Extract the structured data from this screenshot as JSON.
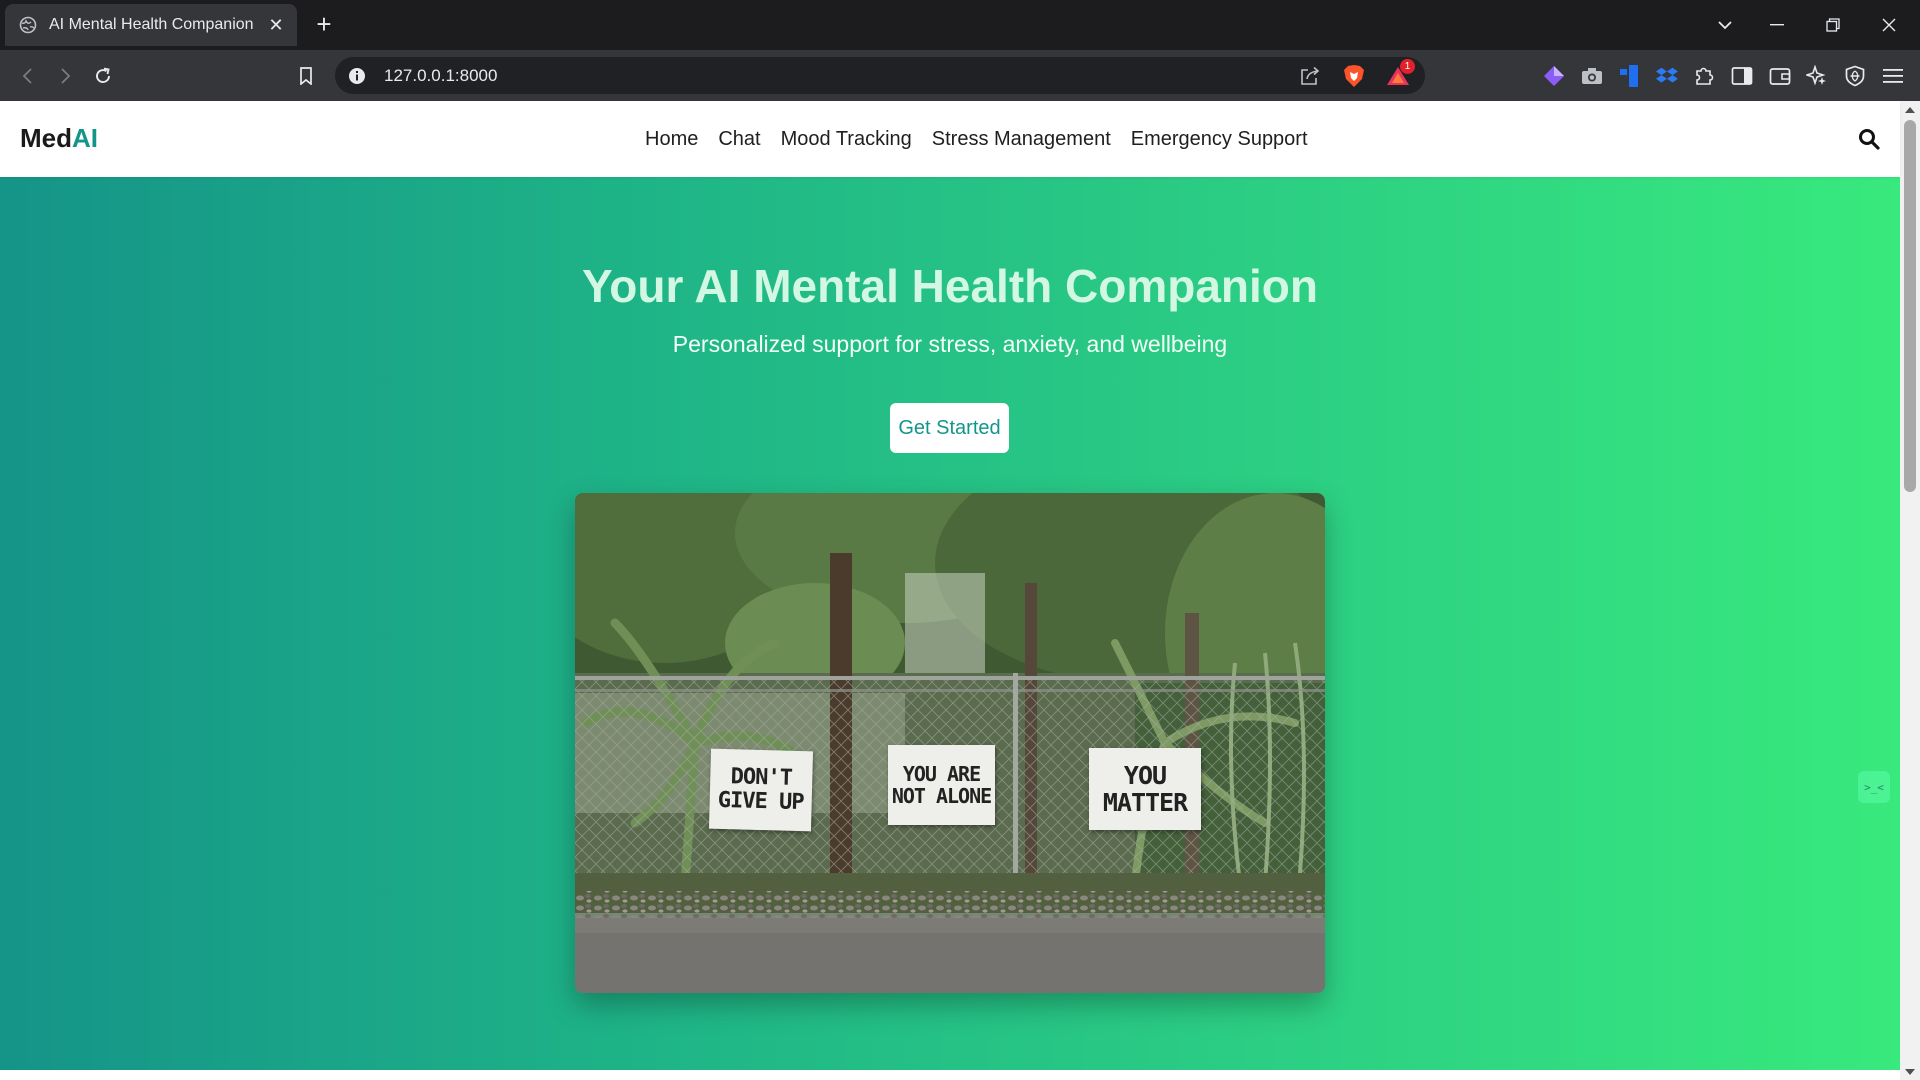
{
  "browser": {
    "tab": {
      "title": "AI Mental Health Companion",
      "favicon": "globe-icon",
      "close": "✕"
    },
    "new_tab": "+",
    "address": {
      "url": "127.0.0.1:8000"
    },
    "rewards_badge": "1",
    "extensions": [
      "diamond-extension-icon",
      "camera-extension-icon",
      "trello-extension-icon",
      "dropbox-extension-icon",
      "puzzle-extensions-icon",
      "sidebar-icon",
      "wallet-icon",
      "leo-ai-icon",
      "vpn-shield-icon",
      "menu-icon"
    ]
  },
  "site": {
    "brand": {
      "prefix": "Med",
      "accent": "AI"
    },
    "nav": [
      "Home",
      "Chat",
      "Mood Tracking",
      "Stress Management",
      "Emergency Support"
    ],
    "hero": {
      "title": "Your AI Mental Health Companion",
      "subtitle": "Personalized support for stress, anxiety, and wellbeing",
      "cta": "Get Started"
    },
    "image_signs": [
      "DON'T\nGIVE UP",
      "YOU ARE\nNOT ALONE",
      "YOU\nMATTER"
    ],
    "assistant_fab": ">_<"
  },
  "colors": {
    "accent": "#13968a",
    "gradient_start": "#159488",
    "gradient_end": "#38e97d",
    "chrome_dark": "#1c1c1f",
    "toolbar": "#35363a"
  }
}
